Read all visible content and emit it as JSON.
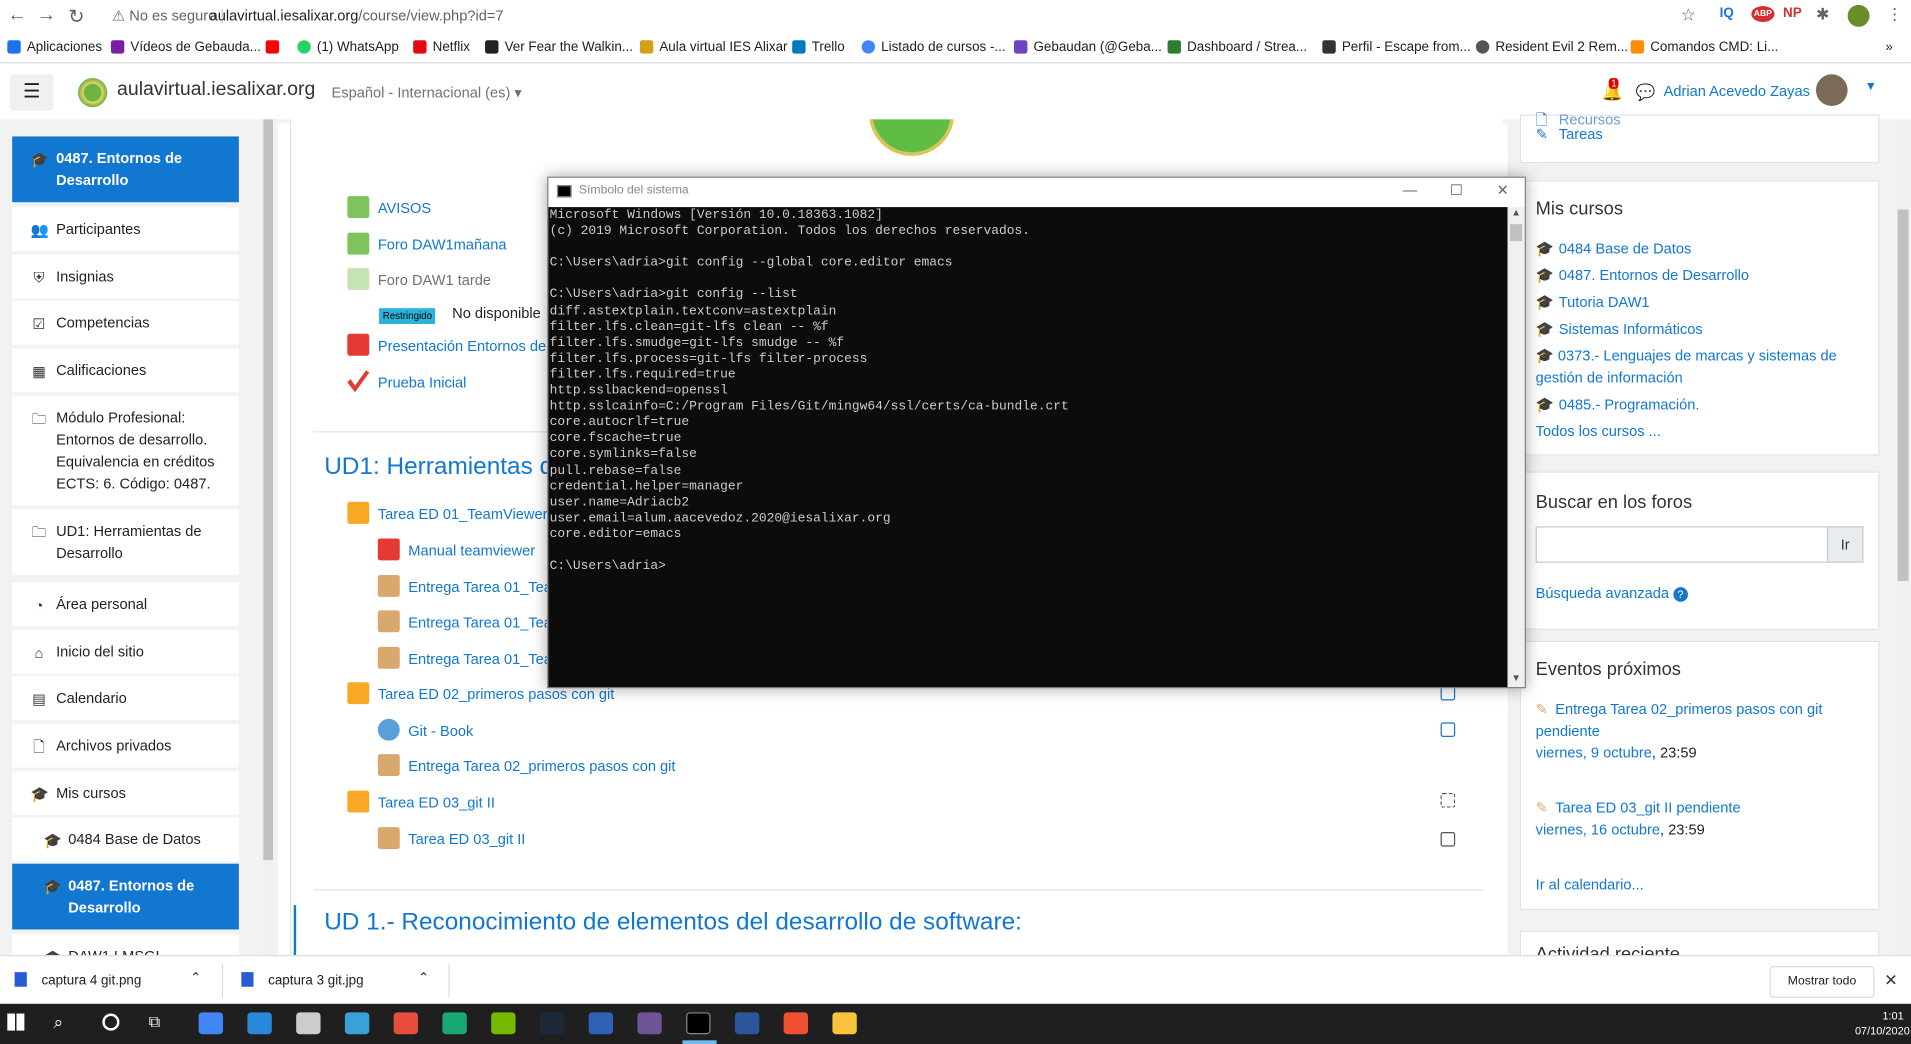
{
  "browser": {
    "security_text": "No es seguro",
    "url_host": "aulavirtual.iesalixar.org",
    "url_path": "/course/view.php?id=7",
    "bookmarks": [
      {
        "label": "Aplicaciones",
        "color": "#1a73e8"
      },
      {
        "label": "Vídeos de Gebauda...",
        "color": "#7b1fa2"
      },
      {
        "label": "",
        "color": "#ff0000"
      },
      {
        "label": "(1) WhatsApp",
        "color": "#25d366"
      },
      {
        "label": "Netflix",
        "color": "#e50914"
      },
      {
        "label": "Ver Fear the Walkin...",
        "color": "#222222"
      },
      {
        "label": "Aula virtual IES Alixar",
        "color": "#d4a017"
      },
      {
        "label": "Trello",
        "color": "#0079bf"
      },
      {
        "label": "Listado de cursos -...",
        "color": "#4285f4"
      },
      {
        "label": "Gebaudan (@Geba...",
        "color": "#6f42c1"
      },
      {
        "label": "Dashboard / Strea...",
        "color": "#2e7d32"
      },
      {
        "label": "Perfil - Escape from...",
        "color": "#333333"
      },
      {
        "label": "Resident Evil 2 Rem...",
        "color": "#555555"
      },
      {
        "label": "Comandos CMD: Li...",
        "color": "#ff8f00"
      }
    ],
    "extensions": [
      "IQ",
      "ABP",
      "NP"
    ]
  },
  "header": {
    "site_name": "aulavirtual.iesalixar.org",
    "language": "Español - Internacional (es)",
    "notification_count": "1",
    "user_name": "Adrian Acevedo Zayas"
  },
  "drawer": {
    "items": [
      {
        "label": "0487. Entornos de Desarrollo",
        "icon": "graduation-cap-icon",
        "active": true
      },
      {
        "label": "Participantes",
        "icon": "users-icon"
      },
      {
        "label": "Insignias",
        "icon": "shield-icon"
      },
      {
        "label": "Competencias",
        "icon": "checkbox-icon"
      },
      {
        "label": "Calificaciones",
        "icon": "table-icon"
      },
      {
        "label": "Módulo Profesional: Entornos de desarrollo. Equivalencia en créditos ECTS: 6. Código: 0487.",
        "icon": "folder-icon"
      },
      {
        "label": "UD1: Herramientas de Desarrollo",
        "icon": "folder-icon"
      },
      {
        "label": "Área personal",
        "icon": "dashboard-icon"
      },
      {
        "label": "Inicio del sitio",
        "icon": "home-icon"
      },
      {
        "label": "Calendario",
        "icon": "calendar-icon"
      },
      {
        "label": "Archivos privados",
        "icon": "file-icon"
      },
      {
        "label": "Mis cursos",
        "icon": "graduation-cap-icon"
      },
      {
        "label": "0484 Base de Datos",
        "icon": "graduation-cap-icon"
      },
      {
        "label": "0487. Entornos de Desarrollo",
        "icon": "graduation-cap-icon",
        "active": true
      },
      {
        "label": "DAW1 LMSGI",
        "icon": "graduation-cap-icon"
      }
    ]
  },
  "course": {
    "activities_top": [
      {
        "label": "AVISOS",
        "icon": "forum-icon"
      },
      {
        "label": "Foro DAW1mañana",
        "icon": "forum-icon"
      },
      {
        "label": "Foro DAW1 tarde",
        "icon": "forum-icon"
      },
      {
        "label": "Presentación Entornos de",
        "icon": "pdf-icon"
      },
      {
        "label": "Prueba Inicial",
        "icon": "quiz-icon"
      }
    ],
    "restricted_badge": "Restringido",
    "not_available": "No disponible",
    "section1_title": "UD1: Herramientas d",
    "section1_items": [
      {
        "label": "Tarea ED 01_TeamViewer",
        "icon": "folder-icon"
      },
      {
        "label": "Manual teamviewer",
        "icon": "pdf-icon"
      },
      {
        "label": "Entrega Tarea 01_Tear",
        "icon": "assignment-icon"
      },
      {
        "label": "Entrega Tarea 01_Tear",
        "icon": "assignment-icon"
      },
      {
        "label": "Entrega Tarea 01_Tear",
        "icon": "assignment-icon"
      },
      {
        "label": "Tarea ED 02_primeros pasos con git",
        "icon": "folder-icon"
      },
      {
        "label": "Git - Book",
        "icon": "url-icon"
      },
      {
        "label": "Entrega Tarea 02_primeros pasos con git",
        "icon": "assignment-icon"
      },
      {
        "label": "Tarea ED 03_git II",
        "icon": "folder-icon"
      },
      {
        "label": "Tarea ED 03_git II",
        "icon": "assignment-icon"
      }
    ],
    "section2_title": "UD 1.- Reconocimiento de elementos del desarrollo de software:"
  },
  "right": {
    "nav_partial": [
      "Recursos",
      "Tareas"
    ],
    "mycourses_title": "Mis cursos",
    "mycourses": [
      "0484 Base de Datos",
      "0487. Entornos de Desarrollo",
      "Tutoria DAW1",
      "Sistemas Informáticos",
      "0373.- Lenguajes de marcas y sistemas de gestión de información",
      "0485.- Programación."
    ],
    "all_courses": "Todos los cursos ...",
    "search_title": "Buscar en los foros",
    "search_button": "Ir",
    "advanced_search": "Búsqueda avanzada",
    "events_title": "Eventos próximos",
    "events": [
      {
        "title": "Entrega Tarea 02_primeros pasos con git pendiente",
        "date": "viernes, 9 octubre",
        "time": ", 23:59"
      },
      {
        "title": "Tarea ED 03_git II pendiente",
        "date": "viernes, 16 octubre",
        "time": ", 23:59"
      }
    ],
    "go_calendar": "Ir al calendario...",
    "recent_activity": "Actividad reciente"
  },
  "cmd": {
    "title": "Símbolo del sistema",
    "lines": [
      "Microsoft Windows [Versión 10.0.18363.1082]",
      "(c) 2019 Microsoft Corporation. Todos los derechos reservados.",
      "",
      "C:\\Users\\adria>git config --global core.editor emacs",
      "",
      "C:\\Users\\adria>git config --list",
      "diff.astextplain.textconv=astextplain",
      "filter.lfs.clean=git-lfs clean -- %f",
      "filter.lfs.smudge=git-lfs smudge -- %f",
      "filter.lfs.process=git-lfs filter-process",
      "filter.lfs.required=true",
      "http.sslbackend=openssl",
      "http.sslcainfo=C:/Program Files/Git/mingw64/ssl/certs/ca-bundle.crt",
      "core.autocrlf=true",
      "core.fscache=true",
      "core.symlinks=false",
      "pull.rebase=false",
      "credential.helper=manager",
      "user.name=Adriacb2",
      "user.email=alum.aacevedoz.2020@iesalixar.org",
      "core.editor=emacs",
      "",
      "C:\\Users\\adria>"
    ]
  },
  "downloads": {
    "items": [
      "captura 4 git.png",
      "captura 3 git.jpg"
    ],
    "show_all": "Mostrar todo"
  },
  "taskbar": {
    "apps": [
      {
        "name": "chrome",
        "color": "#4285f4"
      },
      {
        "name": "task-app",
        "color": "#2b88d8"
      },
      {
        "name": "obs",
        "color": "#cccccc"
      },
      {
        "name": "photos",
        "color": "#3aa0d8"
      },
      {
        "name": "sourcetree",
        "color": "#e74c3c"
      },
      {
        "name": "gitkraken",
        "color": "#19a974"
      },
      {
        "name": "nvidia",
        "color": "#76b900"
      },
      {
        "name": "steam",
        "color": "#1b2838"
      },
      {
        "name": "virtualbox",
        "color": "#2f61b4"
      },
      {
        "name": "github-desktop",
        "color": "#6e5494"
      },
      {
        "name": "cmd",
        "color": "#000000"
      },
      {
        "name": "word",
        "color": "#2b579a"
      },
      {
        "name": "git",
        "color": "#f05032"
      },
      {
        "name": "explorer",
        "color": "#f8c43b"
      }
    ],
    "time": "1:01",
    "date": "07/10/2020"
  }
}
